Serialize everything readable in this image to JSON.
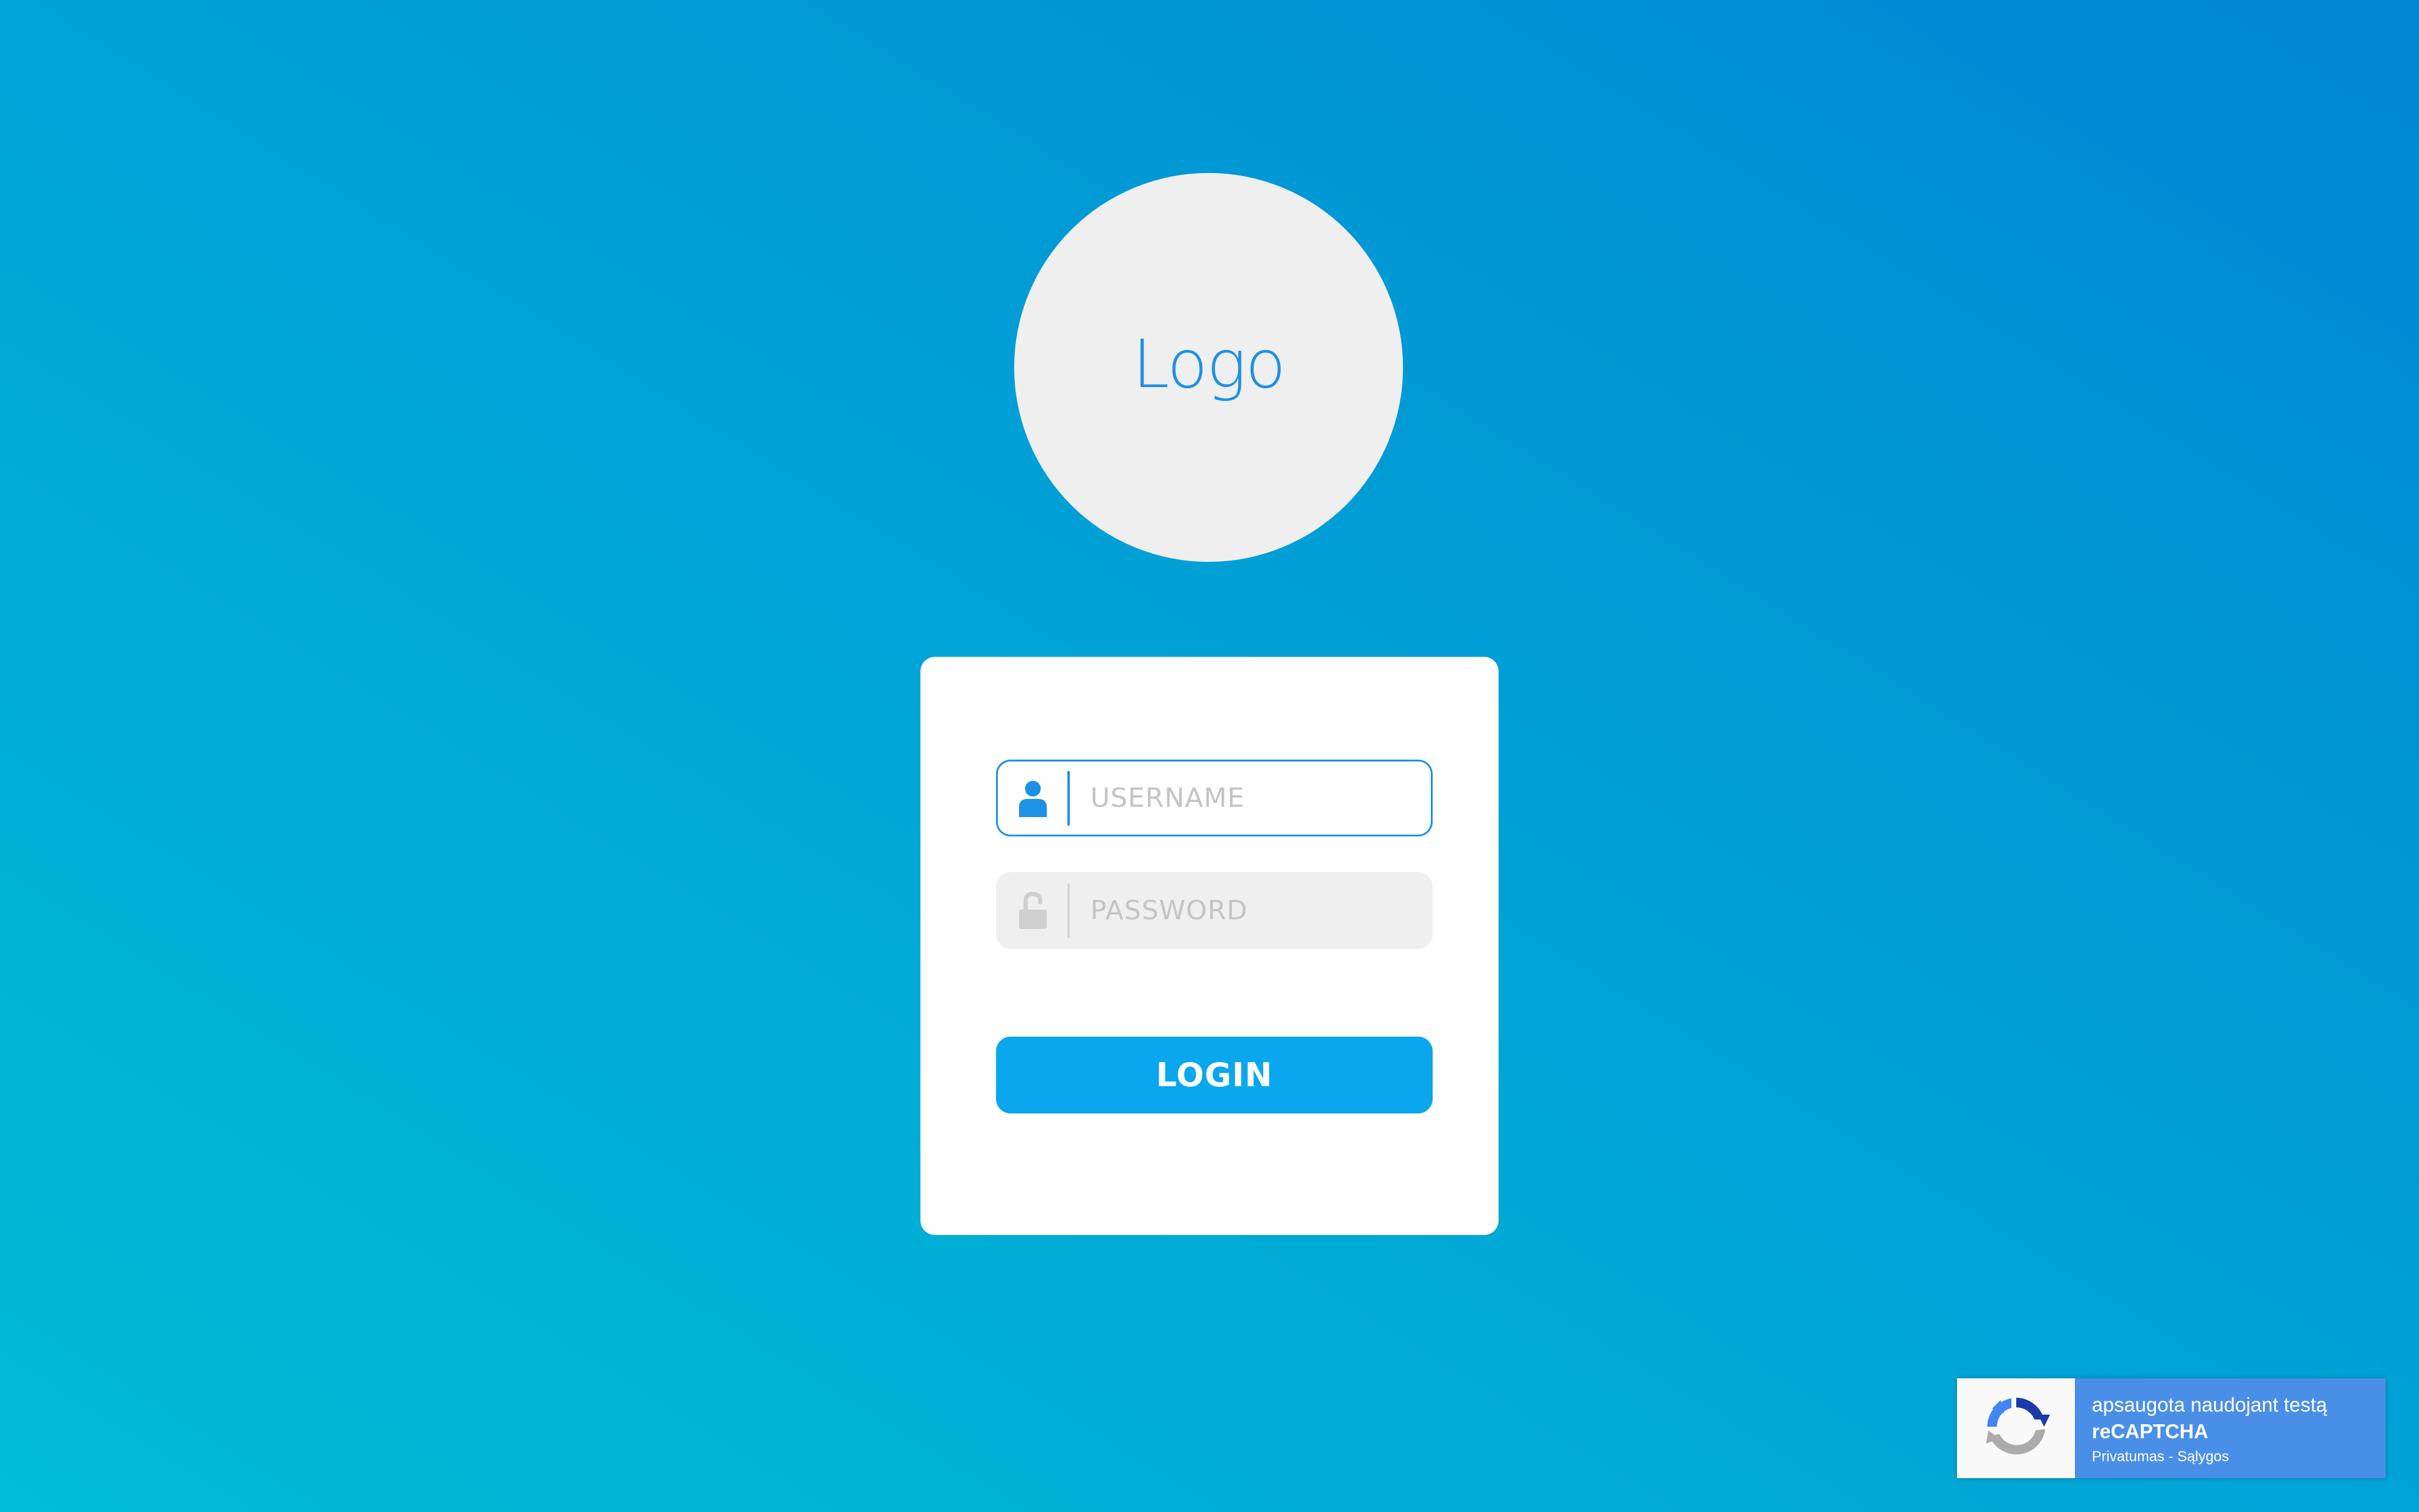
{
  "logo": {
    "text": "Logo"
  },
  "form": {
    "username": {
      "placeholder": "USERNAME",
      "value": ""
    },
    "password": {
      "placeholder": "PASSWORD",
      "value": ""
    },
    "login_label": "LOGIN"
  },
  "recaptcha": {
    "line1": "apsaugota naudojant testą",
    "line2": "reCAPTCHA",
    "privacy_link": "Privatumas",
    "separator": " - ",
    "terms_link": "Sąlygos"
  },
  "colors": {
    "background_start": "#00bcd6",
    "background_end": "#0086d4",
    "accent": "#1e90e6",
    "login_button": "#0aa6ee",
    "card": "#ffffff",
    "recaptcha_panel": "#4a8fe7"
  },
  "icons": {
    "username": "user-icon",
    "password": "unlock-icon",
    "recaptcha": "recaptcha-logo-icon"
  }
}
